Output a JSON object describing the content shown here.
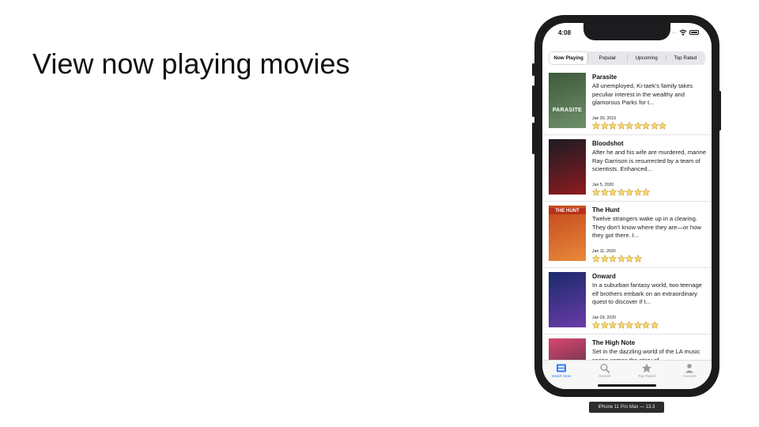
{
  "slide": {
    "title": "View now playing movies"
  },
  "status_bar": {
    "time": "4:08",
    "signal": "...."
  },
  "segments": [
    {
      "label": "Now Playing",
      "selected": true
    },
    {
      "label": "Popular",
      "selected": false
    },
    {
      "label": "Upcoming",
      "selected": false
    },
    {
      "label": "Top Rated",
      "selected": false
    }
  ],
  "movies": [
    {
      "title": "Parasite",
      "overview": "All unemployed, Ki-taek's family takes peculiar interest in the wealthy and glamorous Parks for t...",
      "date": "Jan 30, 2019",
      "stars": 9,
      "poster_text": "PARASITE",
      "poster_colors": [
        "#3d5a3a",
        "#6f8f6a"
      ]
    },
    {
      "title": "Bloodshot",
      "overview": "After he and his wife are murdered, marine Ray Garrison is resurrected by a team of scientists. Enhanced...",
      "date": "Jan 5, 2020",
      "stars": 7,
      "poster_text": "",
      "poster_colors": [
        "#1b1b24",
        "#8e1b1f"
      ]
    },
    {
      "title": "The Hunt",
      "overview": "Twelve strangers wake up in a clearing. They don't know where they are—or how they got there. I...",
      "date": "Jan 11, 2020",
      "stars": 6,
      "poster_text": "THE HUNT",
      "poster_colors": [
        "#c4461d",
        "#e8893b"
      ]
    },
    {
      "title": "Onward",
      "overview": "In a suburban fantasy world, two teenage elf brothers embark on an extraordinary quest to discover if t...",
      "date": "Jan 29, 2020",
      "stars": 8,
      "poster_text": "",
      "poster_colors": [
        "#1a2a6c",
        "#6a3ca8"
      ]
    },
    {
      "title": "The High Note",
      "overview": "Set in the dazzling world of the LA music scene comes the story of...",
      "date": "",
      "stars": 0,
      "poster_text": "",
      "poster_colors": [
        "#d9466f",
        "#2b2b3a"
      ]
    }
  ],
  "tabs": [
    {
      "label": "Watch Now",
      "icon": "film-icon",
      "active": true
    },
    {
      "label": "Search",
      "icon": "search-icon",
      "active": false
    },
    {
      "label": "Top Rated",
      "icon": "star-icon",
      "active": false
    },
    {
      "label": "Account",
      "icon": "person-icon",
      "active": false
    }
  ],
  "device_caption": "iPhone 11 Pro Max — 13.3",
  "colors": {
    "accent": "#2d7cf6",
    "star_fill": "#f7d774",
    "star_stroke": "#c9a02a",
    "device": "#1c1c1e"
  }
}
